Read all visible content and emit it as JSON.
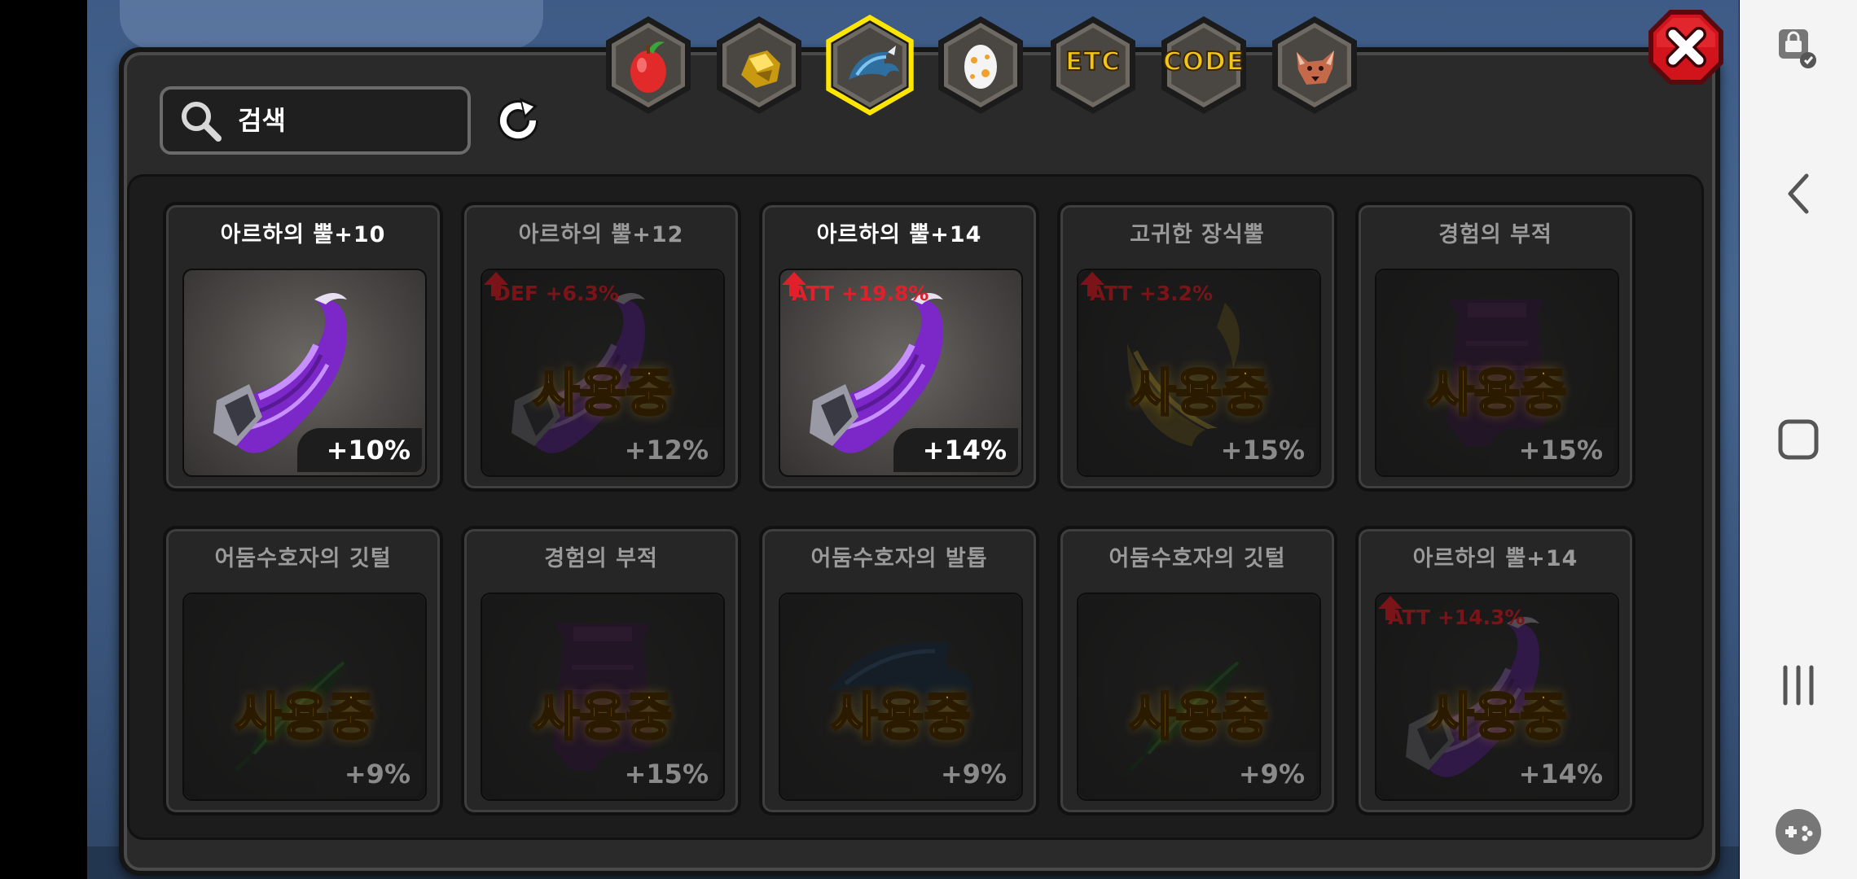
{
  "search": {
    "placeholder": "검색"
  },
  "tabs": [
    {
      "name": "fruit",
      "icon": "fruit-icon",
      "label": ""
    },
    {
      "name": "ore",
      "icon": "ore-icon",
      "label": ""
    },
    {
      "name": "dragon-claw",
      "icon": "dragon-claw-icon",
      "label": "",
      "selected": true
    },
    {
      "name": "egg",
      "icon": "egg-icon",
      "label": ""
    },
    {
      "name": "etc",
      "icon": "",
      "label": "ETC"
    },
    {
      "name": "code",
      "icon": "",
      "label": "CODE"
    },
    {
      "name": "beast",
      "icon": "beast-icon",
      "label": ""
    }
  ],
  "in_use_label": "사용중",
  "items": [
    {
      "title": "아르하의 뿔+10",
      "percent": "+10%",
      "in_use": false,
      "stat": "",
      "art": "horn"
    },
    {
      "title": "아르하의 뿔+12",
      "percent": "+12%",
      "in_use": true,
      "stat": "DEF +6.3%",
      "art": "horn"
    },
    {
      "title": "아르하의 뿔+14",
      "percent": "+14%",
      "in_use": false,
      "stat": "ATT +19.8%",
      "art": "horn"
    },
    {
      "title": "고귀한 장식뿔",
      "percent": "+15%",
      "in_use": true,
      "stat": "ATT +3.2%",
      "art": "ornament"
    },
    {
      "title": "경험의 부적",
      "percent": "+15%",
      "in_use": true,
      "stat": "",
      "art": "talisman"
    },
    {
      "title": "어둠수호자의 깃털",
      "percent": "+9%",
      "in_use": true,
      "stat": "",
      "art": "feather"
    },
    {
      "title": "경험의 부적",
      "percent": "+15%",
      "in_use": true,
      "stat": "",
      "art": "talisman"
    },
    {
      "title": "어둠수호자의 발톱",
      "percent": "+9%",
      "in_use": true,
      "stat": "",
      "art": "claw"
    },
    {
      "title": "어둠수호자의 깃털",
      "percent": "+9%",
      "in_use": true,
      "stat": "",
      "art": "feather"
    },
    {
      "title": "아르하의 뿔+14",
      "percent": "+14%",
      "in_use": true,
      "stat": "ATT +14.3%",
      "art": "horn"
    }
  ],
  "colors": {
    "accent_gold": "#f7c81c",
    "stat_red": "#e0202a",
    "selected_ring": "#ffe600",
    "close_red": "#d1141c"
  }
}
